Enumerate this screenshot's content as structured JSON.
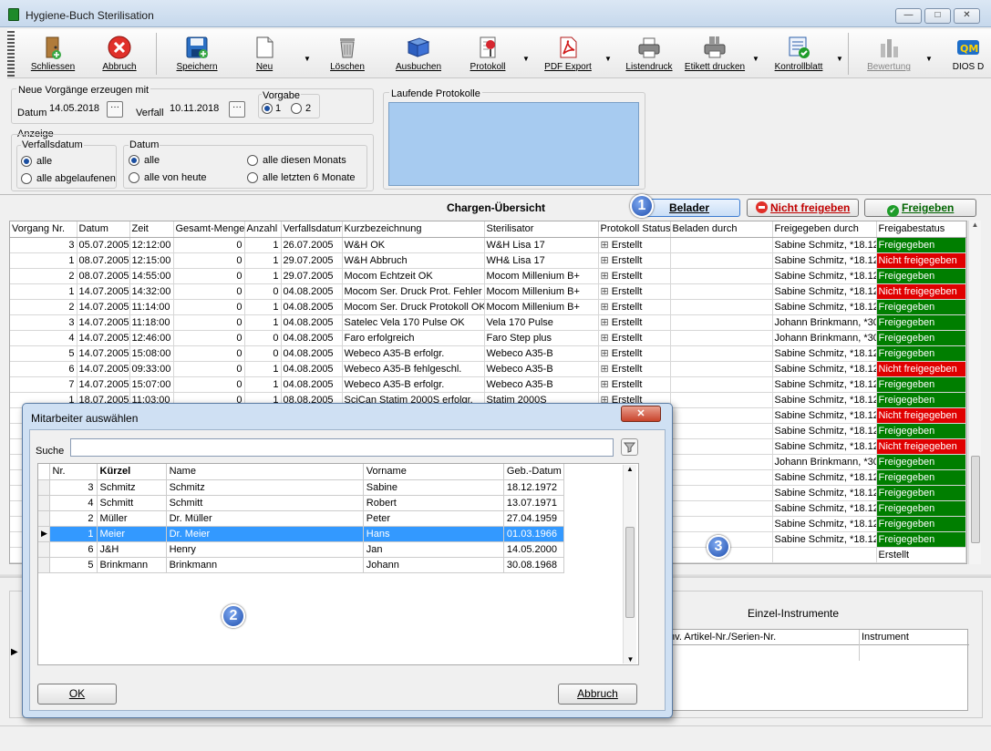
{
  "window": {
    "title": "Hygiene-Buch Sterilisation",
    "minimize": "—",
    "maximize": "□",
    "close": "✕"
  },
  "toolbar": [
    {
      "label": "Schliessen",
      "icon": "exit-door-icon"
    },
    {
      "label": "Abbruch",
      "icon": "cancel-x-icon"
    },
    {
      "label": "Speichern",
      "icon": "save-disk-icon"
    },
    {
      "label": "Neu",
      "icon": "new-page-icon"
    },
    {
      "label": "Löschen",
      "icon": "trash-icon"
    },
    {
      "label": "Ausbuchen",
      "icon": "book-icon"
    },
    {
      "label": "Protokoll",
      "icon": "protocol-pin-icon"
    },
    {
      "label": "PDF Export",
      "icon": "pdf-icon"
    },
    {
      "label": "Listendruck",
      "icon": "printer-icon"
    },
    {
      "label": "Etikett drucken",
      "icon": "label-printer-icon"
    },
    {
      "label": "Kontrollblatt",
      "icon": "checklist-icon"
    },
    {
      "label": "Bewertung",
      "icon": "chart-icon"
    },
    {
      "label": "DIOS D",
      "icon": "qm-icon"
    }
  ],
  "form": {
    "neue_title": "Neue Vorgänge erzeugen mit",
    "datum_label": "Datum",
    "datum_value": "14.05.2018",
    "verfall_label": "Verfall",
    "verfall_value": "10.11.2018",
    "vorgabe_label": "Vorgabe",
    "vorgabe_1": "1",
    "vorgabe_2": "2",
    "dots": "···",
    "laufende_title": "Laufende Protokolle",
    "anzeige_title": "Anzeige",
    "verfallsdatum_title": "Verfallsdatum",
    "vd_alle": "alle",
    "vd_abgelaufen": "alle abgelaufenen",
    "datum_title": "Datum",
    "d_alle": "alle",
    "d_heute": "alle von heute",
    "d_monat": "alle diesen Monats",
    "d_6monate": "alle letzten 6 Monate"
  },
  "chargen": {
    "title": "Chargen-Übersicht",
    "belader_btn": "Belader",
    "nicht_freigeben_btn": "Nicht freigeben",
    "freigeben_btn": "Freigeben"
  },
  "grid": {
    "columns": [
      "Vorgang Nr.",
      "Datum",
      "Zeit",
      "Gesamt-Menge",
      "Anzahl",
      "Verfallsdatum",
      "Kurzbezeichnung",
      "Sterilisator",
      "Protokoll Status",
      "Beladen durch",
      "Freigegeben durch",
      "Freigabestatus"
    ],
    "rows": [
      {
        "nr": "3",
        "datum": "05.07.2005",
        "zeit": "12:12:00",
        "menge": "0",
        "anzahl": "1",
        "verfall": "26.07.2005",
        "kurz": "W&H OK",
        "steri": "W&H Lisa 17",
        "proto": "Erstellt",
        "beladen": "",
        "frei": "Sabine Schmitz, *18.12",
        "status": "Freigegeben",
        "color": "green"
      },
      {
        "nr": "1",
        "datum": "08.07.2005",
        "zeit": "12:15:00",
        "menge": "0",
        "anzahl": "1",
        "verfall": "29.07.2005",
        "kurz": "W&H Abbruch",
        "steri": "WH& Lisa 17",
        "proto": "Erstellt",
        "beladen": "",
        "frei": "Sabine Schmitz, *18.12",
        "status": "Nicht freigegeben",
        "color": "red"
      },
      {
        "nr": "2",
        "datum": "08.07.2005",
        "zeit": "14:55:00",
        "menge": "0",
        "anzahl": "1",
        "verfall": "29.07.2005",
        "kurz": "Mocom Echtzeit OK",
        "steri": "Mocom Millenium B+",
        "proto": "Erstellt",
        "beladen": "",
        "frei": "Sabine Schmitz, *18.12",
        "status": "Freigegeben",
        "color": "green"
      },
      {
        "nr": "1",
        "datum": "14.07.2005",
        "zeit": "14:32:00",
        "menge": "0",
        "anzahl": "0",
        "verfall": "04.08.2005",
        "kurz": "Mocom Ser. Druck Prot. Fehler",
        "steri": "Mocom Millenium B+",
        "proto": "Erstellt",
        "beladen": "",
        "frei": "Sabine Schmitz, *18.12",
        "status": "Nicht freigegeben",
        "color": "red"
      },
      {
        "nr": "2",
        "datum": "14.07.2005",
        "zeit": "11:14:00",
        "menge": "0",
        "anzahl": "1",
        "verfall": "04.08.2005",
        "kurz": "Mocom Ser. Druck Protokoll OK",
        "steri": "Mocom Millenium B+",
        "proto": "Erstellt",
        "beladen": "",
        "frei": "Sabine Schmitz, *18.12",
        "status": "Freigegeben",
        "color": "green"
      },
      {
        "nr": "3",
        "datum": "14.07.2005",
        "zeit": "11:18:00",
        "menge": "0",
        "anzahl": "1",
        "verfall": "04.08.2005",
        "kurz": "Satelec Vela 170 Pulse OK",
        "steri": "Vela 170 Pulse",
        "proto": "Erstellt",
        "beladen": "",
        "frei": "Johann Brinkmann, *30",
        "status": "Freigegeben",
        "color": "green"
      },
      {
        "nr": "4",
        "datum": "14.07.2005",
        "zeit": "12:46:00",
        "menge": "0",
        "anzahl": "0",
        "verfall": "04.08.2005",
        "kurz": "Faro erfolgreich",
        "steri": "Faro Step plus",
        "proto": "Erstellt",
        "beladen": "",
        "frei": "Johann Brinkmann, *30",
        "status": "Freigegeben",
        "color": "green"
      },
      {
        "nr": "5",
        "datum": "14.07.2005",
        "zeit": "15:08:00",
        "menge": "0",
        "anzahl": "0",
        "verfall": "04.08.2005",
        "kurz": "Webeco A35-B erfolgr.",
        "steri": "Webeco A35-B",
        "proto": "Erstellt",
        "beladen": "",
        "frei": "Sabine Schmitz, *18.12",
        "status": "Freigegeben",
        "color": "green"
      },
      {
        "nr": "6",
        "datum": "14.07.2005",
        "zeit": "09:33:00",
        "menge": "0",
        "anzahl": "1",
        "verfall": "04.08.2005",
        "kurz": "Webeco A35-B fehlgeschl.",
        "steri": "Webeco A35-B",
        "proto": "Erstellt",
        "beladen": "",
        "frei": "Sabine Schmitz, *18.12",
        "status": "Nicht freigegeben",
        "color": "red"
      },
      {
        "nr": "7",
        "datum": "14.07.2005",
        "zeit": "15:07:00",
        "menge": "0",
        "anzahl": "1",
        "verfall": "04.08.2005",
        "kurz": "Webeco A35-B erfolgr.",
        "steri": "Webeco A35-B",
        "proto": "Erstellt",
        "beladen": "",
        "frei": "Sabine Schmitz, *18.12",
        "status": "Freigegeben",
        "color": "green"
      },
      {
        "nr": "1",
        "datum": "18.07.2005",
        "zeit": "11:03:00",
        "menge": "0",
        "anzahl": "1",
        "verfall": "08.08.2005",
        "kurz": "SciCan Statim 2000S erfolgr.",
        "steri": "Statim 2000S",
        "proto": "Erstellt",
        "beladen": "",
        "frei": "Sabine Schmitz, *18.12",
        "status": "Freigegeben",
        "color": "green"
      },
      {
        "nr": "",
        "datum": "",
        "zeit": "",
        "menge": "",
        "anzahl": "",
        "verfall": "",
        "kurz": "",
        "steri": "",
        "proto": "",
        "beladen": "",
        "frei": "Sabine Schmitz, *18.12",
        "status": "Nicht freigegeben",
        "color": "red"
      },
      {
        "nr": "",
        "datum": "",
        "zeit": "",
        "menge": "",
        "anzahl": "",
        "verfall": "",
        "kurz": "",
        "steri": "",
        "proto": "",
        "beladen": "",
        "frei": "Sabine Schmitz, *18.12",
        "status": "Freigegeben",
        "color": "green"
      },
      {
        "nr": "",
        "datum": "",
        "zeit": "",
        "menge": "",
        "anzahl": "",
        "verfall": "",
        "kurz": "",
        "steri": "",
        "proto": "",
        "beladen": "",
        "frei": "Sabine Schmitz, *18.12",
        "status": "Nicht freigegeben",
        "color": "red"
      },
      {
        "nr": "",
        "datum": "",
        "zeit": "",
        "menge": "",
        "anzahl": "",
        "verfall": "",
        "kurz": "",
        "steri": "",
        "proto": "",
        "beladen": "",
        "frei": "Johann Brinkmann, *30",
        "status": "Freigegeben",
        "color": "green"
      },
      {
        "nr": "",
        "datum": "",
        "zeit": "",
        "menge": "",
        "anzahl": "",
        "verfall": "",
        "kurz": "",
        "steri": "",
        "proto": "",
        "beladen": "",
        "frei": "Sabine Schmitz, *18.12",
        "status": "Freigegeben",
        "color": "green"
      },
      {
        "nr": "",
        "datum": "",
        "zeit": "",
        "menge": "",
        "anzahl": "",
        "verfall": "",
        "kurz": "",
        "steri": "",
        "proto": "",
        "beladen": "",
        "frei": "Sabine Schmitz, *18.12",
        "status": "Freigegeben",
        "color": "green"
      },
      {
        "nr": "",
        "datum": "",
        "zeit": "",
        "menge": "",
        "anzahl": "",
        "verfall": "",
        "kurz": "",
        "steri": "",
        "proto": "",
        "beladen": "",
        "frei": "Sabine Schmitz, *18.12",
        "status": "Freigegeben",
        "color": "green"
      },
      {
        "nr": "",
        "datum": "",
        "zeit": "",
        "menge": "",
        "anzahl": "",
        "verfall": "",
        "kurz": "",
        "steri": "",
        "proto": "",
        "beladen": "",
        "frei": "Sabine Schmitz, *18.12",
        "status": "Freigegeben",
        "color": "green"
      },
      {
        "nr": "",
        "datum": "",
        "zeit": "",
        "menge": "",
        "anzahl": "",
        "verfall": "",
        "kurz": "",
        "steri": "",
        "proto": "",
        "beladen": "",
        "frei": "Sabine Schmitz, *18.12",
        "status": "Freigegeben",
        "color": "green"
      },
      {
        "nr": "",
        "datum": "",
        "zeit": "",
        "menge": "",
        "anzahl": "",
        "verfall": "",
        "kurz": "",
        "steri": "",
        "proto": "",
        "beladen": "",
        "frei": "",
        "status": "Erstellt",
        "color": "none"
      }
    ]
  },
  "lower": {
    "einzel_title": "Einzel-Instrumente",
    "col_artikel": "Inv. Artikel-Nr./Serien-Nr.",
    "col_instrument": "Instrument"
  },
  "dialog": {
    "title": "Mitarbeiter auswählen",
    "close": "✕",
    "search_label": "Suche",
    "search_value": "",
    "columns": [
      "Nr.",
      "Kürzel",
      "Name",
      "Vorname",
      "Geb.-Datum"
    ],
    "rows": [
      {
        "nr": "3",
        "kurz": "Schmitz",
        "name": "Schmitz",
        "vorname": "Sabine",
        "geb": "18.12.1972",
        "selected": false
      },
      {
        "nr": "4",
        "kurz": "Schmitt",
        "name": "Schmitt",
        "vorname": "Robert",
        "geb": "13.07.1971",
        "selected": false
      },
      {
        "nr": "2",
        "kurz": "Müller",
        "name": "Dr. Müller",
        "vorname": "Peter",
        "geb": "27.04.1959",
        "selected": false
      },
      {
        "nr": "1",
        "kurz": "Meier",
        "name": "Dr. Meier",
        "vorname": "Hans",
        "geb": "01.03.1966",
        "selected": true
      },
      {
        "nr": "6",
        "kurz": "J&H",
        "name": "Henry",
        "vorname": "Jan",
        "geb": "14.05.2000",
        "selected": false
      },
      {
        "nr": "5",
        "kurz": "Brinkmann",
        "name": "Brinkmann",
        "vorname": "Johann",
        "geb": "30.08.1968",
        "selected": false
      }
    ],
    "ok": "OK",
    "abbruch": "Abbruch"
  },
  "badges": [
    "1",
    "2",
    "3"
  ]
}
